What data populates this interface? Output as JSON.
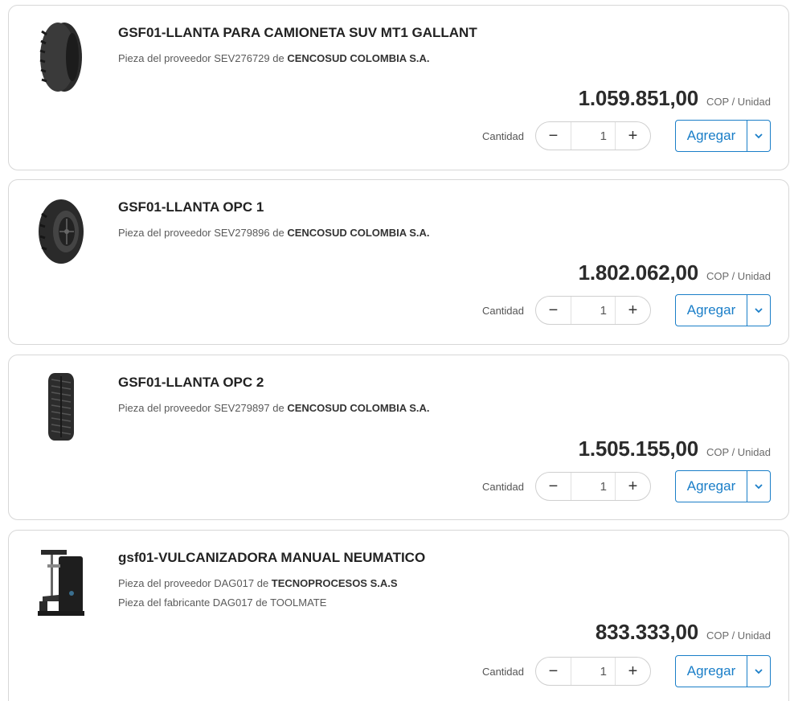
{
  "products": [
    {
      "title": "GSF01-LLANTA PARA CAMIONETA SUV MT1 GALLANT",
      "supplier_prefix": "Pieza del proveedor SEV276729 de ",
      "supplier_name": "CENCOSUD COLOMBIA S.A.",
      "price": "1.059.851,00",
      "unit": "COP / Unidad",
      "quantity_label": "Cantidad",
      "quantity": "1",
      "add_label": "Agregar",
      "image_icon": "tire-side-icon"
    },
    {
      "title": "GSF01-LLANTA OPC 1",
      "supplier_prefix": "Pieza del proveedor SEV279896 de ",
      "supplier_name": "CENCOSUD COLOMBIA S.A.",
      "price": "1.802.062,00",
      "unit": "COP / Unidad",
      "quantity_label": "Cantidad",
      "quantity": "1",
      "add_label": "Agregar",
      "image_icon": "tire-angled-icon"
    },
    {
      "title": "GSF01-LLANTA OPC 2",
      "supplier_prefix": "Pieza del proveedor SEV279897 de ",
      "supplier_name": "CENCOSUD COLOMBIA S.A.",
      "price": "1.505.155,00",
      "unit": "COP / Unidad",
      "quantity_label": "Cantidad",
      "quantity": "1",
      "add_label": "Agregar",
      "image_icon": "tire-tread-icon"
    },
    {
      "title": "gsf01-VULCANIZADORA MANUAL NEUMATICO",
      "supplier_prefix": "Pieza del proveedor DAG017 de ",
      "supplier_name": "TECNOPROCESOS S.A.S",
      "maker": "Pieza del fabricante DAG017 de TOOLMATE",
      "price": "833.333,00",
      "unit": "COP / Unidad",
      "quantity_label": "Cantidad",
      "quantity": "1",
      "add_label": "Agregar",
      "image_icon": "vulcanizer-machine-icon"
    }
  ],
  "icons": {
    "minus": "−",
    "plus": "+",
    "dropdown": "chevron-down-icon"
  },
  "colors": {
    "accent": "#1a7ec8",
    "border": "#d7d7d7"
  }
}
